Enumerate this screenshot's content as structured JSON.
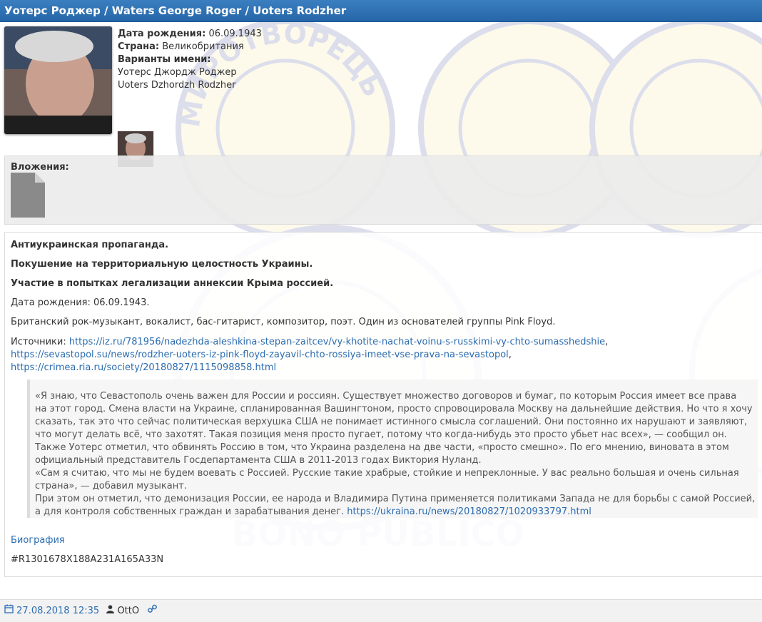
{
  "header": {
    "title": "Уотерс Роджер / Waters George Roger / Uoters Rodzher"
  },
  "profile": {
    "birth_label": "Дата рождения:",
    "birth_value": "06.09.1943",
    "country_label": "Страна:",
    "country_value": "Великобритания",
    "variants_label": "Варианты имени:",
    "variants": [
      "Уотерс Джордж Роджер",
      "Uoters Dzhordzh Rodzher"
    ]
  },
  "attachments": {
    "label": "Вложения:"
  },
  "post": {
    "bold_lines": [
      "Антиукраинская пропаганда.",
      "Покушение на территориальную целостность Украины.",
      "Участие в попытках легализации аннексии Крыма россией."
    ],
    "birth_line": "Дата рождения: 06.09.1943.",
    "bio_line": "Британский рок-музыкант, вокалист, бас-гитарист, композитор, поэт. Один из основателей группы Pink Floyd.",
    "sources_label": "Источники: ",
    "sources": [
      "https://iz.ru/781956/nadezhda-aleshkina-stepan-zaitcev/vy-khotite-nachat-voinu-s-russkimi-vy-chto-sumasshedshie",
      "https://sevastopol.su/news/rodzher-uoters-iz-pink-floyd-zayavil-chto-rossiya-imeet-vse-prava-na-sevastopol",
      "https://crimea.ria.ru/society/20180827/1115098858.html"
    ],
    "quote_lines": [
      "«Я знаю, что Севастополь очень важен для России и россиян. Существует множество договоров и бумаг, по которым Россия имеет все права",
      "на этот город. Смена власти на Украине, спланированная Вашингтоном, просто спровоцировала Москву на дальнейшие действия. Но что я хочу",
      "сказать, так это что сейчас политическая верхушка США не понимает истинного смысла соглашений. Они постоянно их нарушают и заявляют,",
      "что могут делать всё, что захотят. Такая позиция меня просто пугает, потому что когда-нибудь это просто убьет нас всех», — сообщил он.",
      "Также Уотерс отметил, что обвинять Россию в том, что Украина разделена на две части, «просто смешно». По его мнению, виновата в этом",
      "официальный представитель Госдепартамента США в 2011-2013 годах Виктория Нуланд.",
      "«Сам я считаю, что мы не будем воевать с Россией. Русские такие храбрые, стойкие и непреклонные. У вас реально большая и очень сильная",
      "страна», — добавил музыкант.",
      "При этом он отметил, что демонизация России, ее народа и Владимира Путина применяется политиками Запада не для борьбы с самой Россией,",
      "а для контроля собственных граждан и зарабатывания денег.  "
    ],
    "quote_link": "https://ukraina.ru/news/20180827/1020933797.html",
    "bio_link": "Биография",
    "code": "#R1301678X188A231A165A33N"
  },
  "footer": {
    "date": "27.08.2018 12:35",
    "user": "OttO"
  },
  "watermark": {
    "top_text": "МИРОТВОРЕЦЬ",
    "bottom_text": "BONO PUBLICO"
  },
  "colors": {
    "title_bar": "#2566a8",
    "link": "#2b6cb0",
    "seal": "#2d3a8c"
  }
}
